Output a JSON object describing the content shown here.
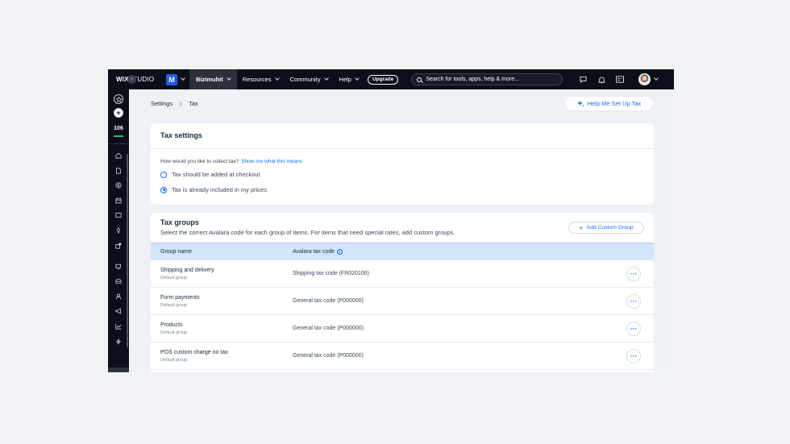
{
  "topbar": {
    "logo_bold": "WIX",
    "logo_rest": "STUDIO",
    "site_badge_letter": "M",
    "site_name": "Bizimuhit",
    "nav": [
      "Resources",
      "Community",
      "Help"
    ],
    "upgrade_label": "Upgrade",
    "search_placeholder": "Search for tools, apps, help & more...",
    "icons": [
      "chat-icon",
      "bell-icon",
      "browser-icon",
      "avatar"
    ]
  },
  "sidebar": {
    "count": "106",
    "icons": [
      "home-icon",
      "documents-icon",
      "dollar-icon",
      "store-icon",
      "media-icon",
      "pen-icon",
      "apps-icon",
      "devices-icon",
      "inbox-icon",
      "contacts-icon",
      "megaphone-icon",
      "analytics-icon",
      "automation-icon"
    ]
  },
  "breadcrumb": {
    "items": [
      "Settings",
      "Tax"
    ]
  },
  "help_button": "Help Me Set Up Tax",
  "tax_settings": {
    "title": "Tax settings",
    "question": "How would you like to collect tax?",
    "question_link": "Show me what this means",
    "options": [
      {
        "label": "Tax should be added at checkout",
        "selected": false
      },
      {
        "label": "Tax is already included in my prices",
        "selected": true
      }
    ]
  },
  "tax_groups": {
    "title": "Tax groups",
    "subtitle": "Select the correct Avalara code for each group of items. For items that need special rates, add custom groups.",
    "add_button": "Add Custom Group",
    "columns": [
      "Group name",
      "Avalara tax code"
    ],
    "rows": [
      {
        "name": "Shipping and delivery",
        "sub": "Default group",
        "code": "Shipping tax code (FR020100)"
      },
      {
        "name": "Form payments",
        "sub": "Default group",
        "code": "General tax code (P000000)"
      },
      {
        "name": "Products",
        "sub": "Default group",
        "code": "General tax code (P000000)"
      },
      {
        "name": "POS custom charge no tax",
        "sub": "Default group",
        "code": "General tax code (P000000)"
      }
    ]
  },
  "colors": {
    "accent": "#116dff",
    "topbar": "#0b0f1a",
    "table_header": "#d3e4fd"
  }
}
